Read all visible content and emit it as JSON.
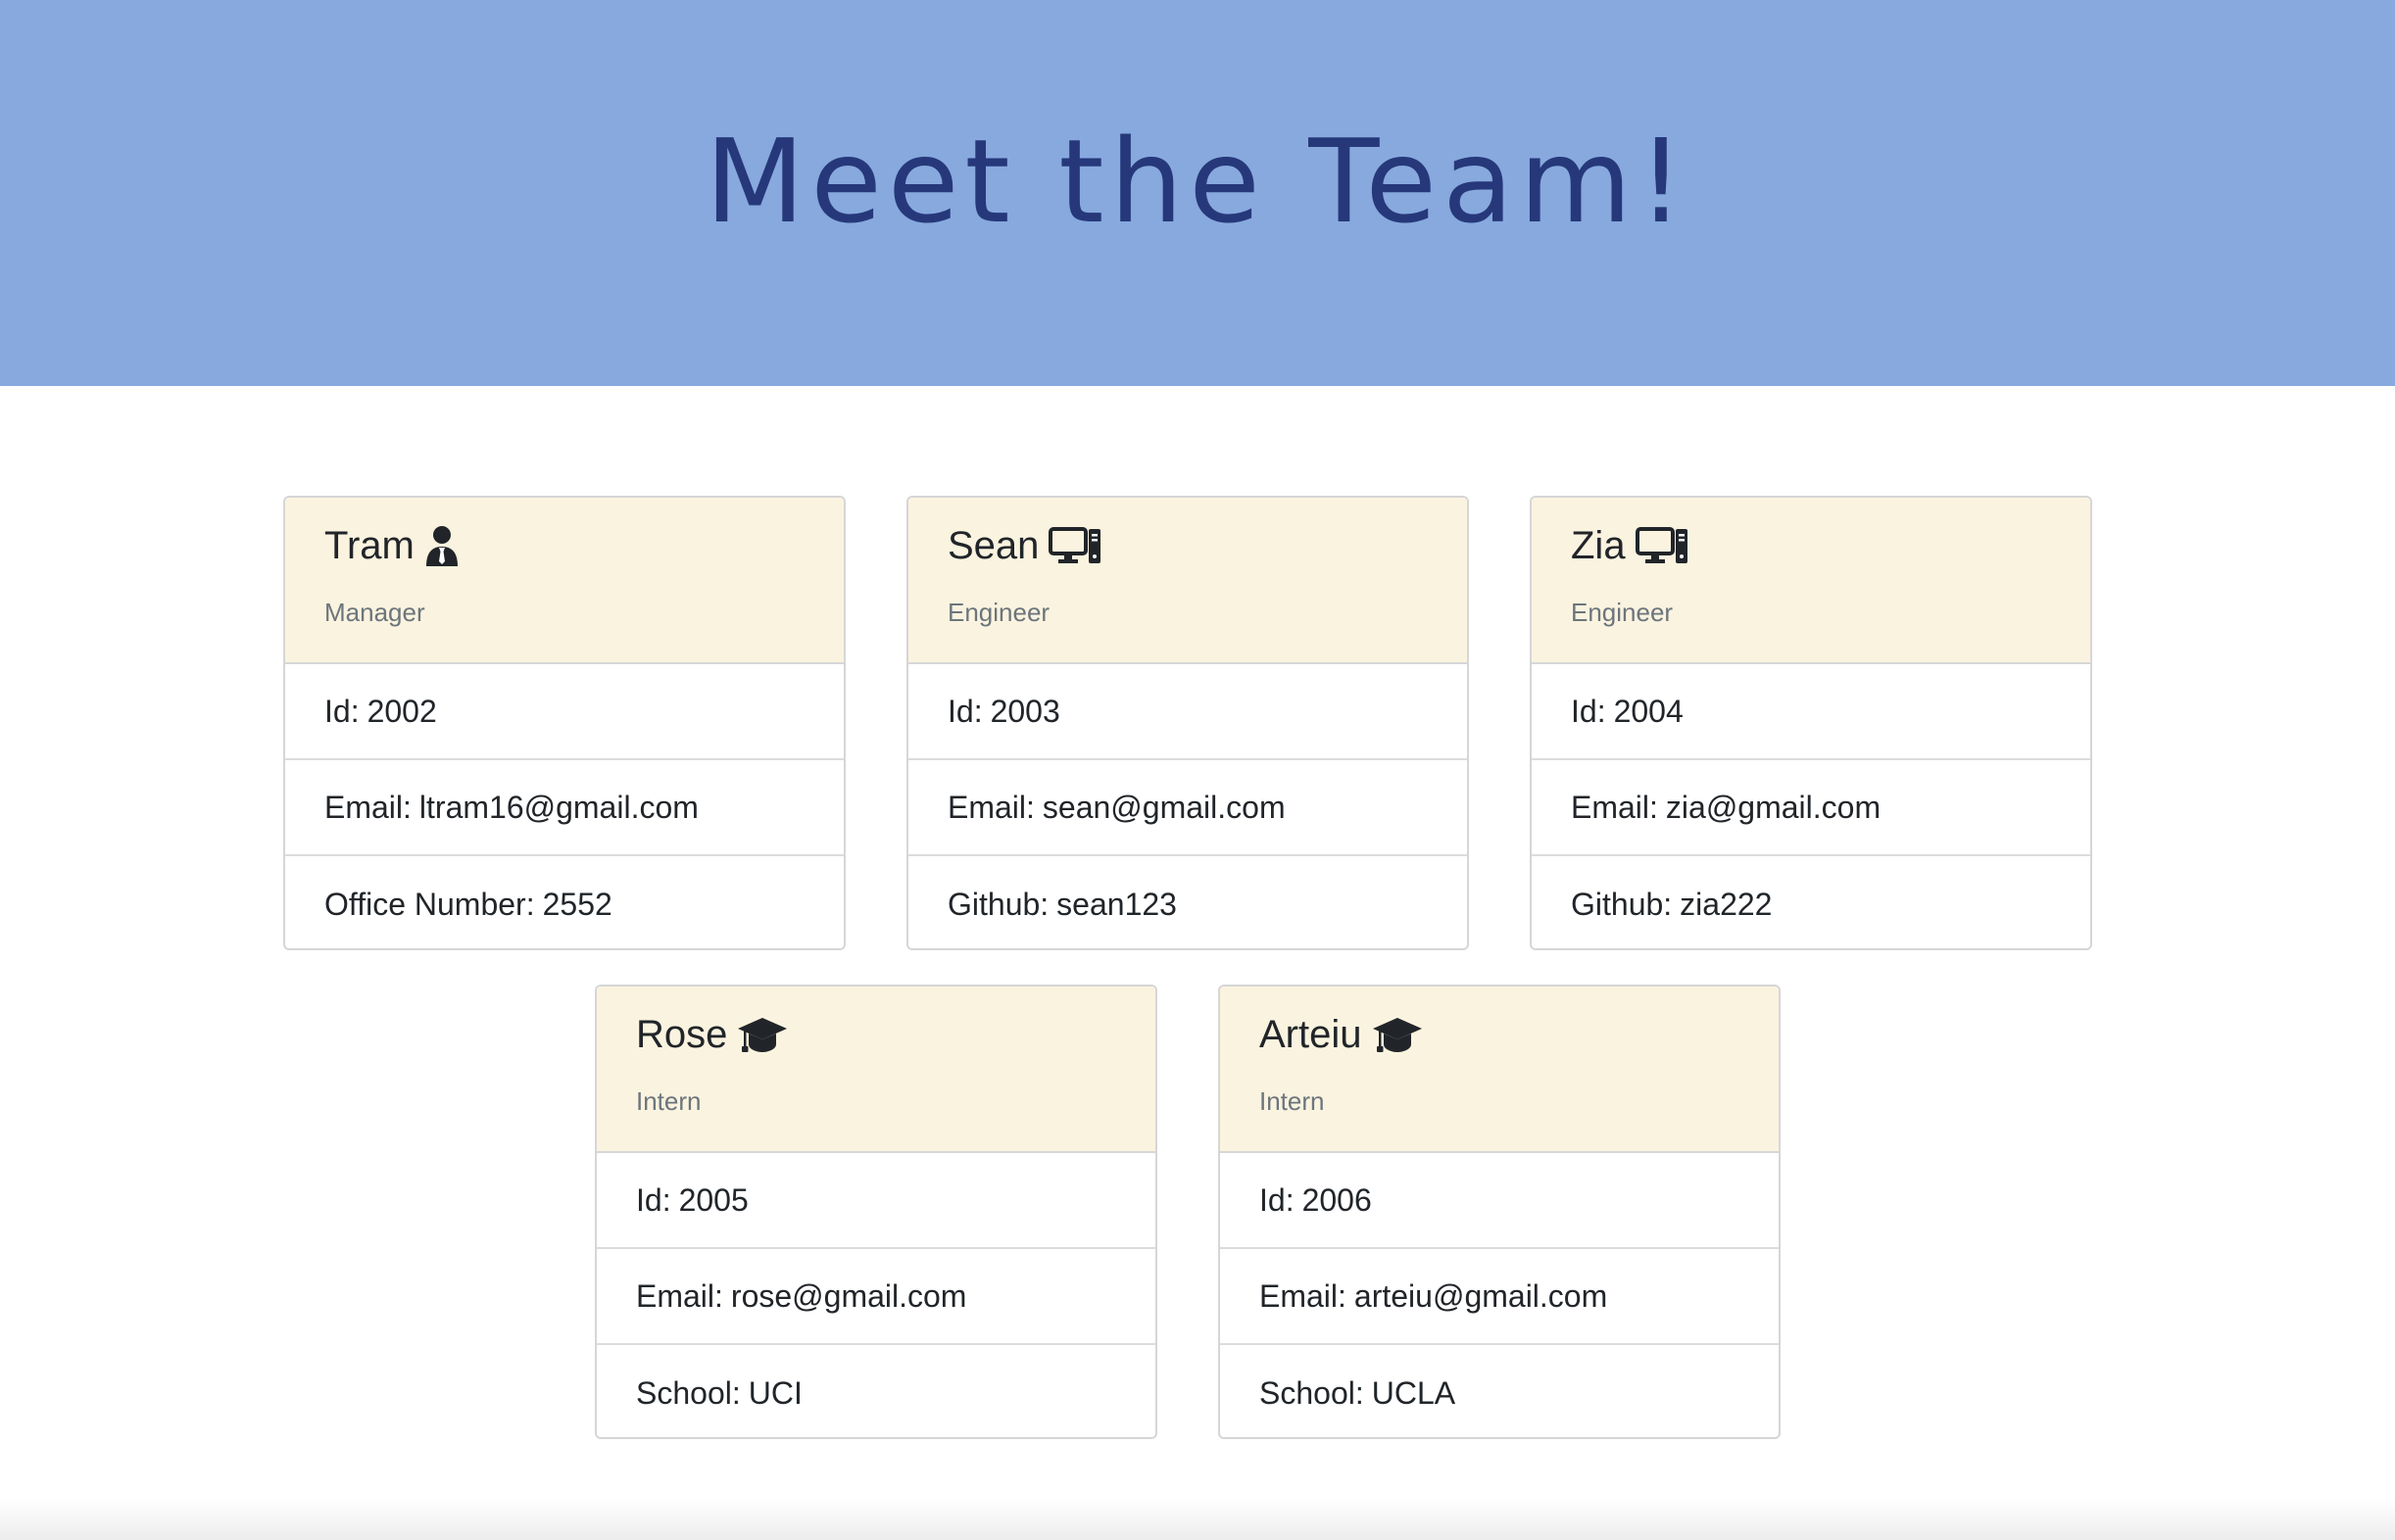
{
  "header": {
    "title": "Meet the Team!"
  },
  "members": [
    {
      "name": "Tram",
      "icon": "manager-icon",
      "role": "Manager",
      "id": "2002",
      "email": "ltram16@gmail.com",
      "extra_label": "Office Number:",
      "extra_value": "2552"
    },
    {
      "name": "Sean",
      "icon": "computer-icon",
      "role": "Engineer",
      "id": "2003",
      "email": "sean@gmail.com",
      "extra_label": "Github:",
      "extra_value": "sean123"
    },
    {
      "name": "Zia",
      "icon": "computer-icon",
      "role": "Engineer",
      "id": "2004",
      "email": "zia@gmail.com",
      "extra_label": "Github:",
      "extra_value": "zia222"
    },
    {
      "name": "Rose",
      "icon": "graduation-cap-icon",
      "role": "Intern",
      "id": "2005",
      "email": "rose@gmail.com",
      "extra_label": "School:",
      "extra_value": "UCI"
    },
    {
      "name": "Arteiu",
      "icon": "graduation-cap-icon",
      "role": "Intern",
      "id": "2006",
      "email": "arteiu@gmail.com",
      "extra_label": "School:",
      "extra_value": "UCLA"
    }
  ],
  "labels": {
    "id": "Id:",
    "email": "Email:"
  },
  "colors": {
    "banner": "#87a9de",
    "title": "#26387a",
    "card_header": "#faf3df"
  }
}
